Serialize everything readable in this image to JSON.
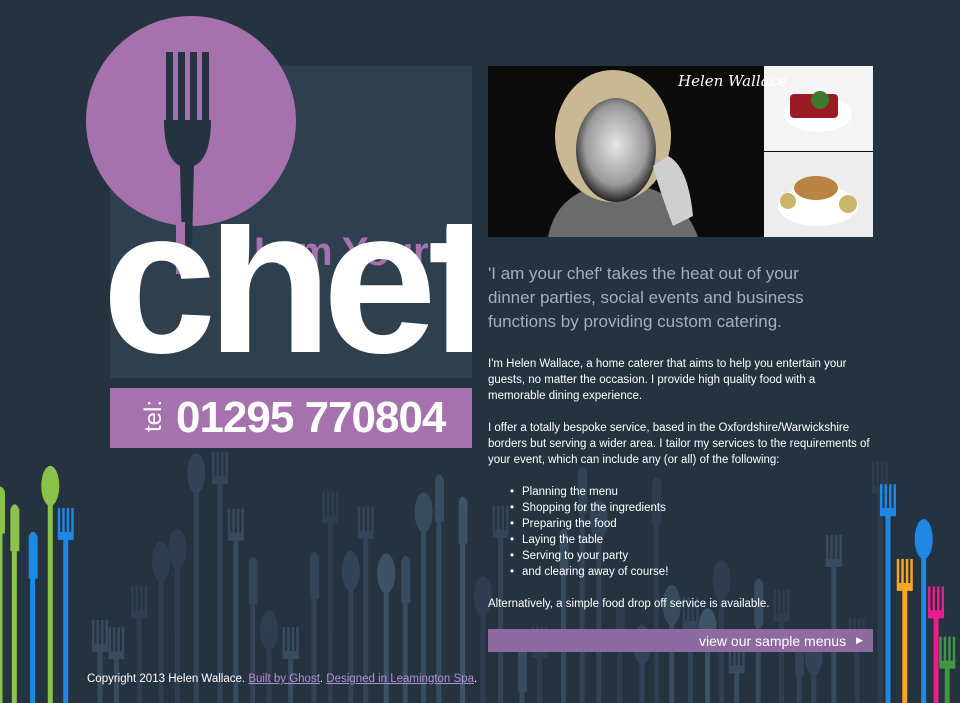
{
  "logo": {
    "tagline": "I am Your",
    "word": "chef",
    "tel_label": "tel:",
    "tel_number": "01295 770804",
    "fork_icon": "fork-icon"
  },
  "photo": {
    "caption": "Helen Wallace"
  },
  "intro": "'I am your chef' takes the heat out of your dinner parties, social events and business functions by providing custom catering.",
  "paragraphs": [
    "I'm Helen Wallace, a home caterer that aims to help you entertain your guests, no matter the occasion. I provide high quality food with a memorable dining experience.",
    "I offer a totally bespoke service, based in the Oxfordshire/Warwickshire borders but serving a wider area. I tailor my services to the requirements of your event, which can include any (or all) of the following:"
  ],
  "services": [
    "Planning the menu",
    "Shopping for the ingredients",
    "Preparing the food",
    "Laying the table",
    "Serving to your party",
    "and clearing away of course!"
  ],
  "closing": "Alternatively, a simple food drop off service is available.",
  "menu_button": {
    "label": "view our sample menus",
    "icon": "arrow-right-icon"
  },
  "footer": {
    "copyright": "Copyright 2013 Helen Wallace.",
    "built_by": "Built by Ghost",
    "designed_in": "Designed in Leamington Spa",
    "separator": ". ",
    "end": "."
  },
  "colors": {
    "background": "#253240",
    "accent": "#a572ae",
    "button": "#8d6aa0",
    "intro_text": "#a7aebb"
  }
}
